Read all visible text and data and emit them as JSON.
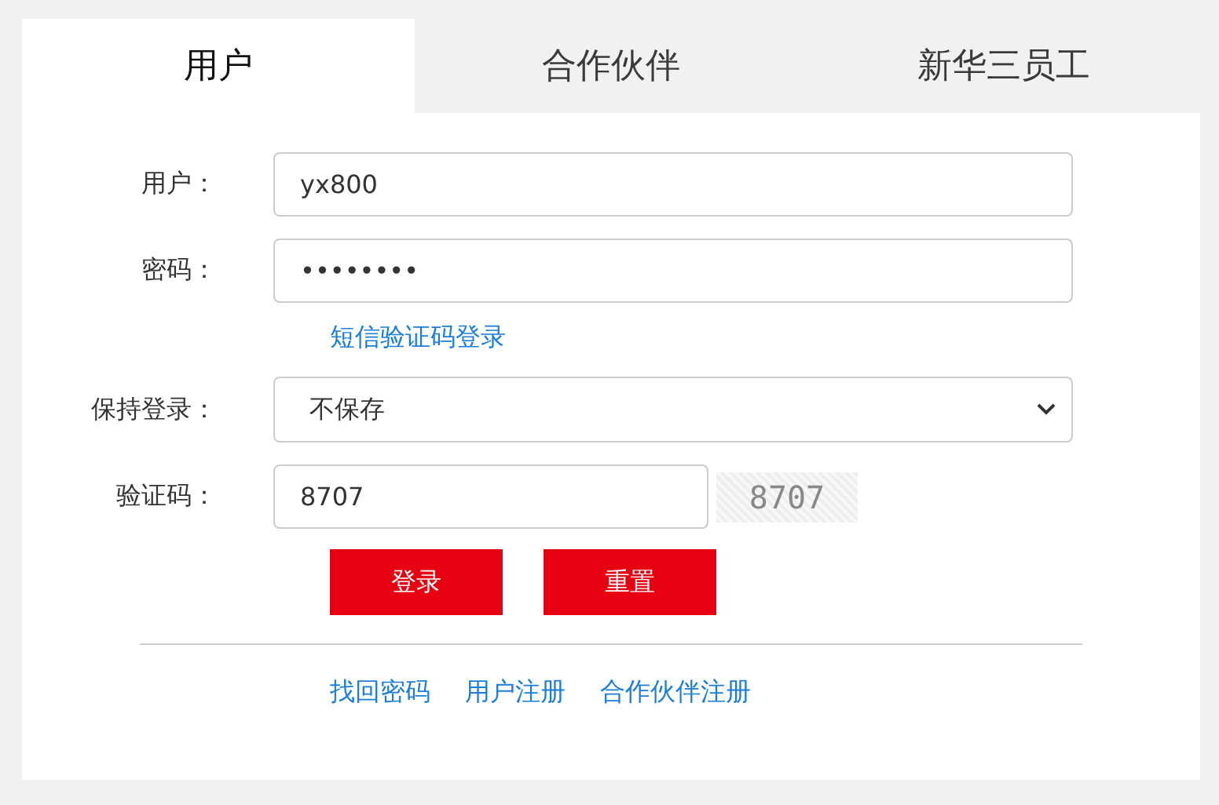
{
  "tabs": [
    {
      "label": "用户",
      "selected": true
    },
    {
      "label": "合作伙伴",
      "selected": false
    },
    {
      "label": "新华三员工",
      "selected": false
    }
  ],
  "form": {
    "fields": [
      {
        "kind": "text",
        "label": "用户：",
        "value": "yx800"
      },
      {
        "kind": "password",
        "label": "密码：",
        "value": "••••••••"
      },
      {
        "kind": "link",
        "text": "短信验证码登录"
      },
      {
        "kind": "select",
        "label": "保持登录：",
        "value": "不保存"
      },
      {
        "kind": "captcha",
        "label": "验证码：",
        "value": "8707",
        "captcha": "8707"
      }
    ],
    "buttons": [
      "登录",
      "重置"
    ],
    "links": [
      "找回密码",
      "用户注册",
      "合作伙伴注册"
    ]
  }
}
